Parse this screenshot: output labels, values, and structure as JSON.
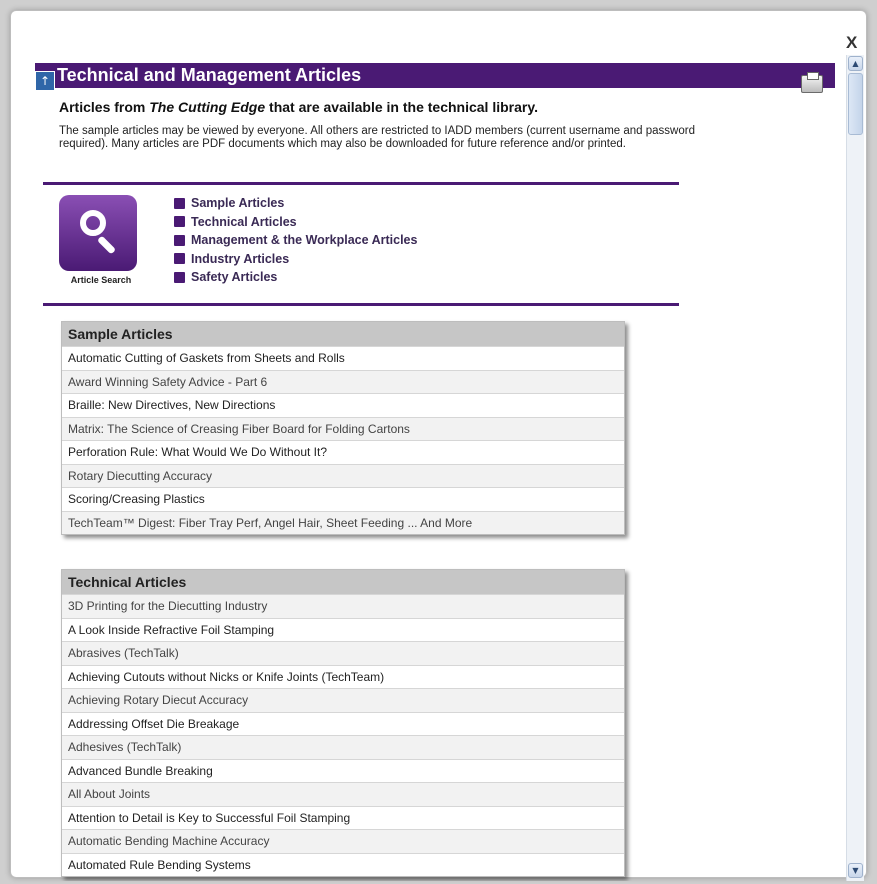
{
  "dialog": {
    "close_label": "X"
  },
  "header": {
    "title": "Technical and Management Articles",
    "subtitle_pre": "Articles from ",
    "subtitle_em": "The Cutting Edge",
    "subtitle_post": " that are available in the technical library.",
    "intro": "The sample articles may be viewed by everyone. All others are restricted to IADD members (current username and password required). Many articles are PDF documents which may also be downloaded for future reference and/or printed."
  },
  "search": {
    "label": "Article Search"
  },
  "categories": [
    "Sample Articles",
    "Technical Articles",
    "Management & the Workplace Articles",
    "Industry Articles",
    "Safety Articles"
  ],
  "sample_table": {
    "header": "Sample Articles",
    "rows": [
      "Automatic Cutting of Gaskets from Sheets and Rolls",
      "Award Winning Safety Advice - Part 6",
      "Braille: New Directives, New Directions",
      "Matrix: The Science of Creasing Fiber Board for Folding Cartons",
      "Perforation Rule: What Would We Do Without It?",
      "Rotary Diecutting Accuracy",
      "Scoring/Creasing Plastics",
      "TechTeam™ Digest: Fiber Tray Perf, Angel Hair, Sheet Feeding ... And More"
    ]
  },
  "technical_table": {
    "header": "Technical Articles",
    "rows": [
      "3D Printing for the Diecutting Industry",
      "A Look Inside Refractive Foil Stamping",
      "Abrasives (TechTalk)",
      "Achieving Cutouts without Nicks or Knife Joints (TechTeam)",
      "Achieving Rotary Diecut Accuracy",
      "Addressing Offset Die Breakage",
      "Adhesives (TechTalk)",
      "Advanced Bundle Breaking",
      "All About Joints",
      "Attention to Detail is Key to Successful Foil Stamping",
      "Automatic Bending Machine Accuracy",
      "Automated Rule Bending Systems"
    ]
  },
  "colors": {
    "brand": "#4a1a74",
    "header_gray": "#c6c6c6"
  },
  "icons": [
    "close-icon",
    "scroll-to-top-icon",
    "print-icon",
    "search-icon",
    "bullet-square-icon",
    "scroll-up-icon",
    "scroll-down-icon"
  ]
}
